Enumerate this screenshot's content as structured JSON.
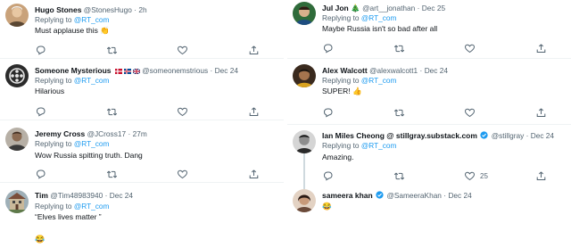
{
  "left": [
    {
      "name": "Hugo Stones",
      "handle": "@StonesHugo",
      "dot": "·",
      "time": "2h",
      "replying": "Replying to",
      "replying_to": "@RT_com",
      "text": "Must applause this",
      "emoji": "👏"
    },
    {
      "name": "Someone Mysterious",
      "handle": "@someonemstrious",
      "dot": "·",
      "time": "Dec 24",
      "replying": "Replying to",
      "replying_to": "@RT_com",
      "text": "Hilarious"
    },
    {
      "name": "Jeremy Cross",
      "handle": "@JCross17",
      "dot": "·",
      "time": "27m",
      "replying": "Replying to",
      "replying_to": "@RT_com",
      "text": "Wow Russia spitting truth. Dang"
    },
    {
      "name": "Tim",
      "handle": "@Tim48983940",
      "dot": "·",
      "time": "Dec 24",
      "replying": "Replying to",
      "replying_to": "@RT_com",
      "text": "“Elves lives matter ”",
      "emoji": "😂"
    }
  ],
  "right": [
    {
      "name": "Jul Jon",
      "name_emoji": "🎄",
      "handle": "@art__jonathan",
      "dot": "·",
      "time": "Dec 25",
      "replying": "Replying to",
      "replying_to": "@RT_com",
      "text": "Maybe Russia isn't so bad after all"
    },
    {
      "name": "Alex Walcott",
      "handle": "@alexwalcott1",
      "dot": "·",
      "time": "Dec 24",
      "replying": "Replying to",
      "replying_to": "@RT_com",
      "text": "SUPER!",
      "emoji": "👍"
    },
    {
      "name": "Ian Miles Cheong @ stillgray.substack.com",
      "handle": "@stillgray",
      "dot": "·",
      "time": "Dec 24",
      "replying": "Replying to",
      "replying_to": "@RT_com",
      "text": "Amazing.",
      "like_count": "25"
    },
    {
      "name": "sameera khan",
      "handle": "@SameeraKhan",
      "dot": "·",
      "time": "Dec 24",
      "emoji": "😂"
    }
  ],
  "colors": {
    "link": "#1d9bf0",
    "muted": "#536471",
    "text": "#0f1419",
    "divider": "#eff3f4",
    "thread": "#cfd9de"
  },
  "icons": [
    "reply-icon",
    "retweet-icon",
    "like-icon",
    "share-icon",
    "verified-badge-icon"
  ]
}
